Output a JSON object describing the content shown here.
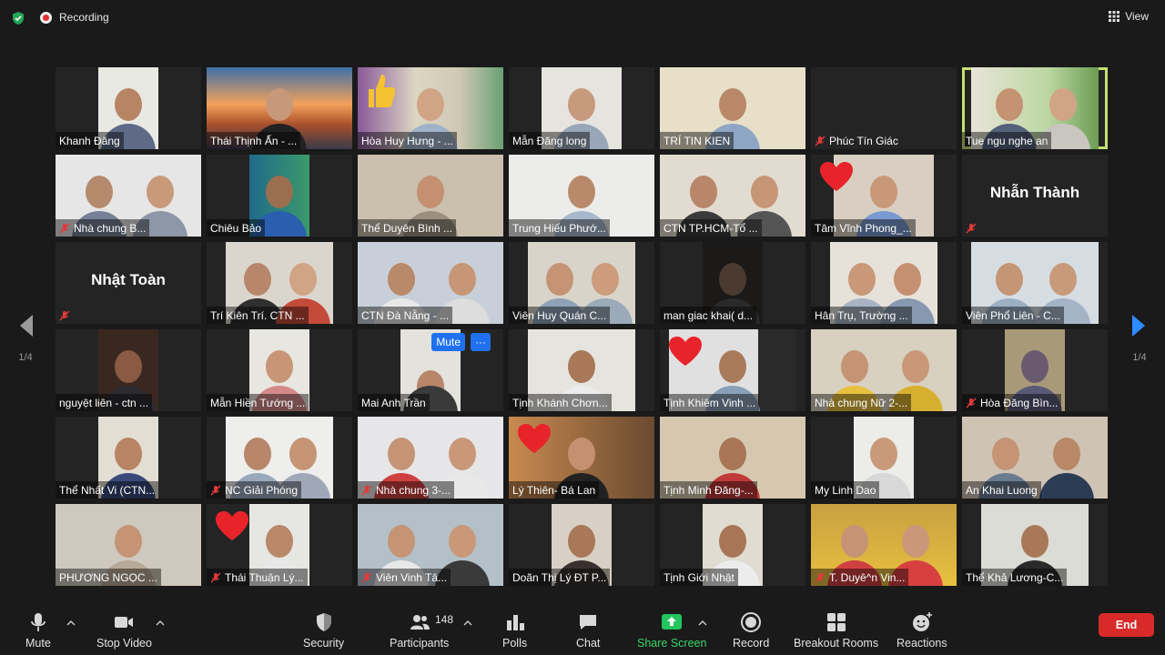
{
  "topbar": {
    "recording_label": "Recording",
    "view_label": "View"
  },
  "pagination": {
    "left_page": "1/4",
    "right_page": "1/4"
  },
  "hover_buttons": {
    "mute": "Mute",
    "more": "···"
  },
  "participants": [
    {
      "name": "Khanh Đăng",
      "muted": false
    },
    {
      "name": "Thái Thịnh Ấn - ...",
      "muted": false
    },
    {
      "name": "Hòa Huy Hưng - ...",
      "muted": false
    },
    {
      "name": "Mẫn Đăng long",
      "muted": false
    },
    {
      "name": "TRÍ TIN KIEN",
      "muted": false
    },
    {
      "name": "Phúc Tín Giác",
      "muted": true
    },
    {
      "name": "Tue ngu nghe an",
      "muted": false
    },
    {
      "name": "Nhà chung B...",
      "muted": true
    },
    {
      "name": "Chiêu Bảo",
      "muted": false
    },
    {
      "name": "Thể Duyên Bình ...",
      "muted": false
    },
    {
      "name": "Trung Hiếu Phướ...",
      "muted": false
    },
    {
      "name": "CTN TP.HCM-Tổ ...",
      "muted": false
    },
    {
      "name": "Tâm Vĩnh Phong_...",
      "muted": false
    },
    {
      "name": "",
      "big": "Nhẫn Thành",
      "muted": true
    },
    {
      "name": "",
      "big": "Nhật Toàn",
      "muted": true
    },
    {
      "name": "Trí Kiên Trí. CTN ...",
      "muted": false
    },
    {
      "name": "CTN Đà Nẵng - ...",
      "muted": false
    },
    {
      "name": "Viên Huy Quán C...",
      "muted": false
    },
    {
      "name": "man giac khai( d...",
      "muted": false
    },
    {
      "name": "Hân Trụ, Trường ...",
      "muted": false
    },
    {
      "name": "Viên Phổ Liên - C...",
      "muted": false
    },
    {
      "name": "nguyệt liên - ctn ...",
      "muted": false
    },
    {
      "name": "Mẫn Hiền Tướng ...",
      "muted": false
    },
    {
      "name": "Mai Anh Trần",
      "muted": false
    },
    {
      "name": "Tịnh Khánh Chơn...",
      "muted": false
    },
    {
      "name": "Tịnh Khiêm Vinh ...",
      "muted": false
    },
    {
      "name": "Nhà chung Nữ 2-...",
      "muted": false
    },
    {
      "name": "Hòa Đăng Bìn...",
      "muted": true
    },
    {
      "name": "Thể Nhất Vi (CTN...",
      "muted": false
    },
    {
      "name": "NC Giải Phóng",
      "muted": true
    },
    {
      "name": "Nhà chung 3-...",
      "muted": true
    },
    {
      "name": "Lý Thiên- Bá Lan",
      "muted": false
    },
    {
      "name": "Tịnh Minh Đăng-...",
      "muted": false
    },
    {
      "name": "My Linh Dao",
      "muted": false
    },
    {
      "name": "An Khai Luong",
      "muted": false
    },
    {
      "name": "PHƯƠNG NGỌC ...",
      "muted": false
    },
    {
      "name": "Thái Thuận Lý...",
      "muted": true
    },
    {
      "name": "Viên Vinh Tâ...",
      "muted": true
    },
    {
      "name": "Doãn Thị Lý ĐT P...",
      "muted": false
    },
    {
      "name": "Tịnh Giới Nhật",
      "muted": false
    },
    {
      "name": "T. Duyê^n Vin...",
      "muted": true
    },
    {
      "name": "Thể Khả Lương-C...",
      "muted": false
    }
  ],
  "toolbar": {
    "mute": "Mute",
    "stop_video": "Stop Video",
    "security": "Security",
    "participants": "Participants",
    "participants_count": "148",
    "polls": "Polls",
    "chat": "Chat",
    "share_screen": "Share Screen",
    "record": "Record",
    "breakout_rooms": "Breakout Rooms",
    "reactions": "Reactions",
    "end": "End"
  },
  "colors": {
    "background": "#1a1a1a",
    "active_speaker": "#c6e070",
    "share_green": "#39d56a",
    "end_red": "#d92a2a",
    "hover_blue": "#1f71f0"
  }
}
